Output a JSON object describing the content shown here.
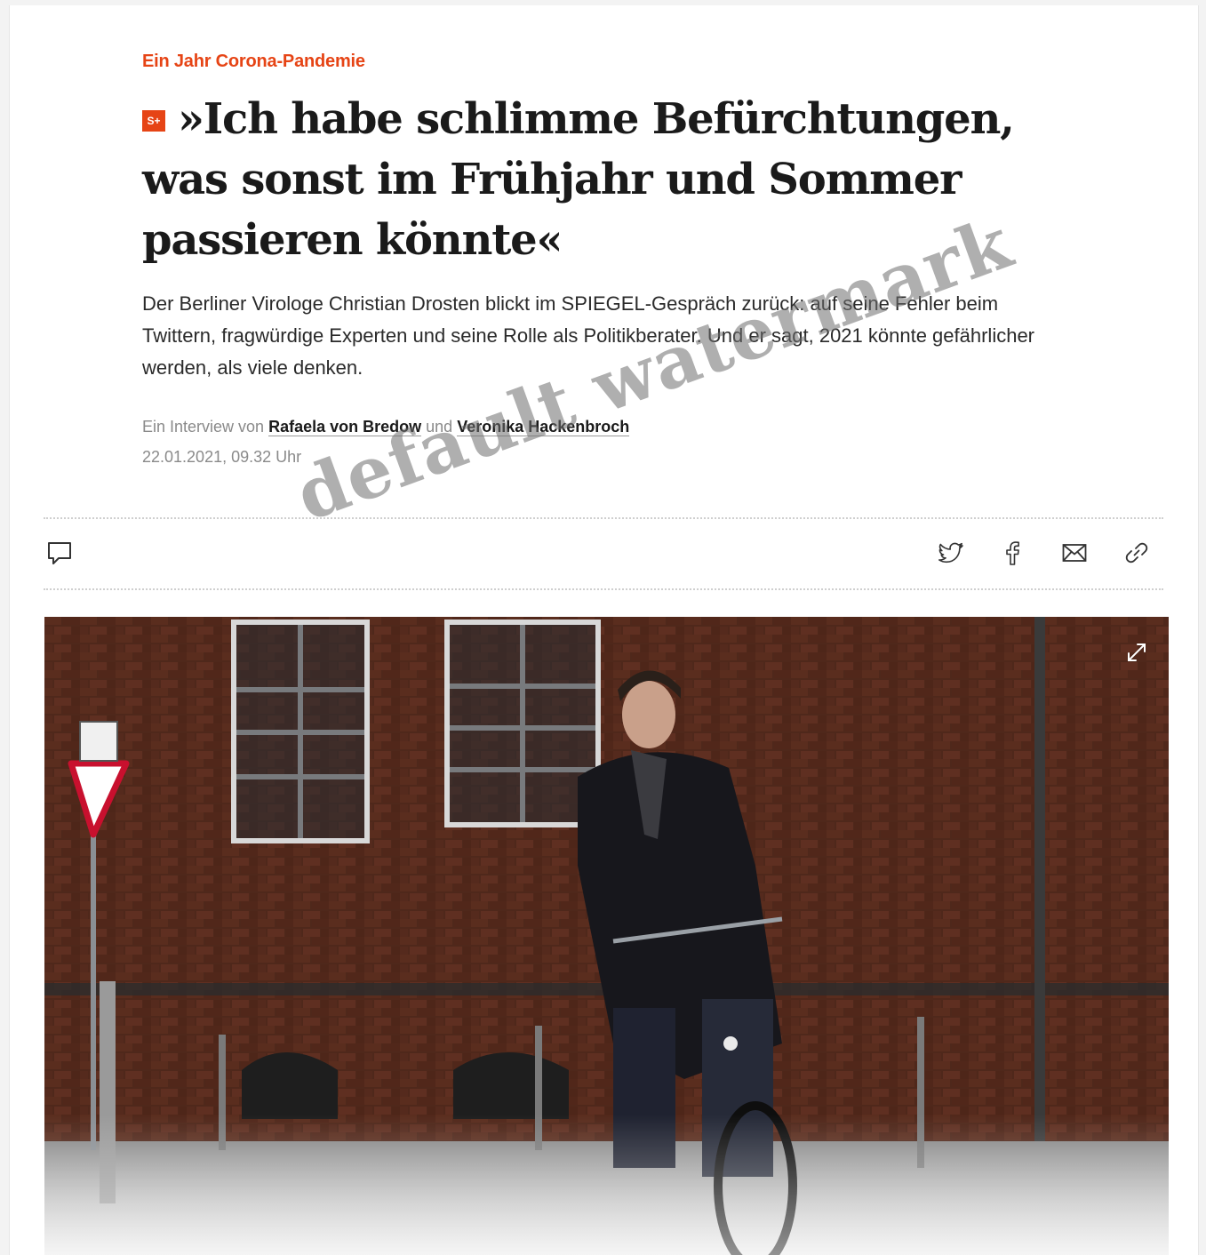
{
  "article": {
    "kicker": "Ein Jahr Corona-Pandemie",
    "plus_badge": "S+",
    "headline": "»Ich habe schlimme Befürchtungen, was sonst im Frühjahr und Sommer passieren könnte«",
    "teaser": "Der Berliner Virologe Christian Drosten blickt im SPIEGEL-Gespräch zurück: auf seine Fehler beim Twittern, fragwürdige Experten und seine Rolle als Politikberater. Und er sagt, 2021 könnte gefährlicher werden, als viele denken.",
    "byline_prefix": "Ein Interview von",
    "author_1": "Rafaela von Bredow",
    "byline_join": "und",
    "author_2": "Veronika Hackenbroch",
    "date": "22.01.2021, 09.32 Uhr"
  },
  "actions": {
    "icons": [
      "comment-icon",
      "twitter-icon",
      "facebook-icon",
      "mail-icon",
      "link-icon",
      "expand-icon"
    ]
  },
  "watermark": "default watermark",
  "colors": {
    "accent": "#e64415",
    "headline": "#1a1a1a",
    "muted": "#8a8a8a"
  }
}
